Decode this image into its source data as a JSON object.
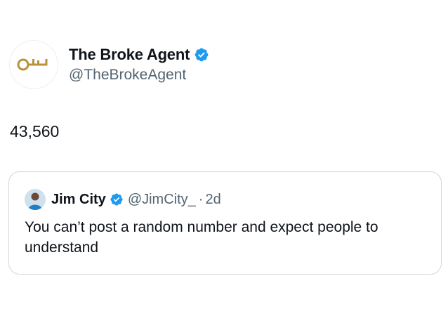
{
  "author": {
    "display_name": "The Broke Agent",
    "handle": "@TheBrokeAgent",
    "verified": true,
    "avatar_icon": "key-logo-icon"
  },
  "tweet": {
    "text": "43,560"
  },
  "quoted_tweet": {
    "display_name": "Jim City",
    "handle": "@JimCity_",
    "separator": "·",
    "time": "2d",
    "verified": true,
    "text": "You can’t post a random number and expect people to understand"
  },
  "colors": {
    "verified_blue": "#1d9bf0",
    "secondary_text": "#536471",
    "border": "#cfd9de",
    "key_gold": "#b8923a"
  }
}
